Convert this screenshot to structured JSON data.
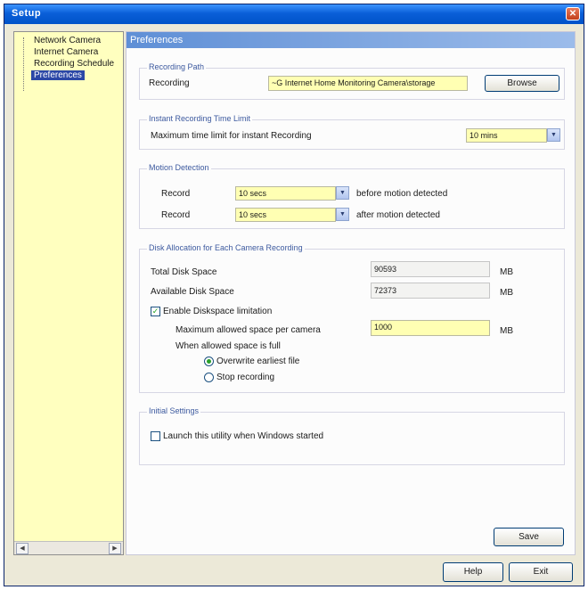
{
  "window": {
    "title": "Setup"
  },
  "nav": {
    "items": [
      {
        "label": "Network Camera",
        "selected": false
      },
      {
        "label": "Internet Camera",
        "selected": false
      },
      {
        "label": "Recording Schedule",
        "selected": false
      },
      {
        "label": "Preferences",
        "selected": true
      }
    ]
  },
  "main": {
    "header": "Preferences",
    "recording_path": {
      "title": "Recording Path",
      "label": "Recording",
      "value": "~G Internet Home Monitoring Camera\\storage",
      "browse_label": "Browse"
    },
    "instant_recording": {
      "title": "Instant Recording Time Limit",
      "label": "Maximum time limit for instant Recording",
      "value": "10 mins"
    },
    "motion_detection": {
      "title": "Motion Detection",
      "before": {
        "label": "Record",
        "value": "10 secs",
        "suffix": "before motion detected"
      },
      "after": {
        "label": "Record",
        "value": "10 secs",
        "suffix": "after motion detected"
      }
    },
    "disk_allocation": {
      "title": "Disk Allocation for Each Camera Recording",
      "total_label": "Total Disk Space",
      "total_value": "90593",
      "total_unit": "MB",
      "available_label": "Available Disk Space",
      "available_value": "72373",
      "available_unit": "MB",
      "enable_label": "Enable Diskspace limitation",
      "max_label": "Maximum allowed space per camera",
      "max_value": "1000",
      "max_unit": "MB",
      "when_full_label": "When allowed space is full",
      "overwrite_label": "Overwrite earliest file",
      "stop_label": "Stop recording"
    },
    "initial_settings": {
      "title": "Initial Settings",
      "launch_label": "Launch this utility when Windows started"
    },
    "save_label": "Save"
  },
  "footer": {
    "help_label": "Help",
    "exit_label": "Exit"
  }
}
